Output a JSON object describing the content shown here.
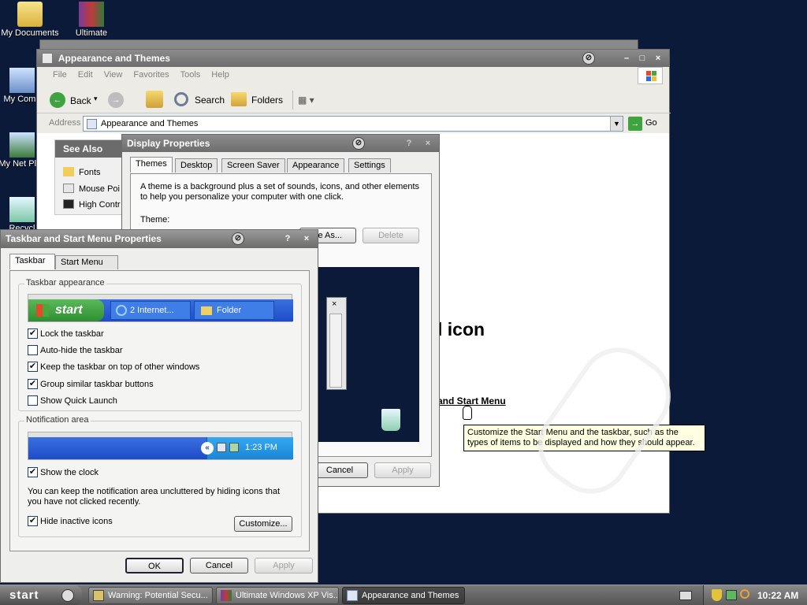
{
  "desktop": {
    "icons": [
      {
        "label": "My Documents"
      },
      {
        "label": "Ultimate"
      },
      {
        "label": "My Comp"
      },
      {
        "label": "My Net Plac"
      },
      {
        "label": "Recycl"
      }
    ]
  },
  "appearance_window": {
    "title": "Appearance and Themes",
    "menu": [
      "File",
      "Edit",
      "View",
      "Favorites",
      "Tools",
      "Help"
    ],
    "toolbar": {
      "back": "Back",
      "search": "Search",
      "folders": "Folders"
    },
    "address_label": "Address",
    "address_value": "Appearance and Themes",
    "go": "Go",
    "see_also_title": "See Also",
    "see_also": [
      "Fonts",
      "Mouse Poi",
      "High Contr"
    ],
    "heading_partial": "l icon",
    "link_partial": "and Start Menu",
    "tooltip": "Customize the Start Menu and the taskbar, such as the types of items to be displayed and how they should appear."
  },
  "display_props": {
    "title": "Display Properties",
    "tabs": [
      "Themes",
      "Desktop",
      "Screen Saver",
      "Appearance",
      "Settings"
    ],
    "description": "A theme is a background plus a set of sounds, icons, and other elements to help you personalize your computer with one click.",
    "theme_label": "Theme:",
    "save_as": "ve As...",
    "delete": "Delete",
    "cancel": "Cancel",
    "apply": "Apply"
  },
  "taskbar_props": {
    "title": "Taskbar and Start Menu Properties",
    "tabs": [
      "Taskbar",
      "Start Menu"
    ],
    "appearance_group": "Taskbar appearance",
    "preview_start": "start",
    "preview_item1": "2 Internet...",
    "preview_item2": "Folder",
    "options": [
      {
        "label": "Lock the taskbar",
        "checked": true
      },
      {
        "label": "Auto-hide the taskbar",
        "checked": false
      },
      {
        "label": "Keep the taskbar on top of other windows",
        "checked": true
      },
      {
        "label": "Group similar taskbar buttons",
        "checked": true
      },
      {
        "label": "Show Quick Launch",
        "checked": false
      }
    ],
    "notification_group": "Notification area",
    "notification_time": "1:23 PM",
    "show_clock": "Show the clock",
    "info": "You can keep the notification area uncluttered by hiding icons that you have not clicked recently.",
    "hide_inactive": "Hide inactive icons",
    "customize": "Customize...",
    "ok": "OK",
    "cancel": "Cancel",
    "apply": "Apply"
  },
  "taskbar": {
    "start": "start",
    "items": [
      "Warning: Potential Secu...",
      "Ultimate Windows XP Vis...",
      "Appearance and Themes"
    ],
    "clock": "10:22 AM"
  }
}
